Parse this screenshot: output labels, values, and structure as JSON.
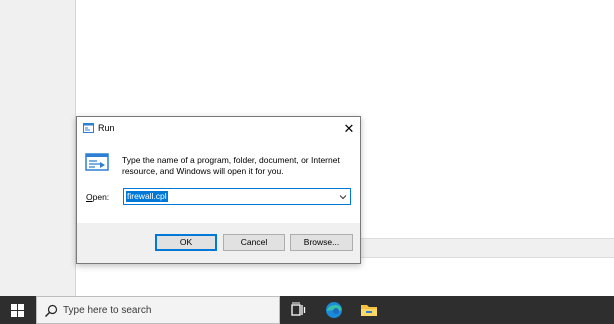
{
  "dialog": {
    "title": "Run",
    "close_glyph": "✕",
    "description": "Type the name of a program, folder, document, or Internet resource, and Windows will open it for you.",
    "open_label_accel": "O",
    "open_label_rest": "pen:",
    "open_value": "firewall.cpl",
    "ok_label": "OK",
    "cancel_label": "Cancel",
    "browse_label": "Browse..."
  },
  "taskbar": {
    "search_placeholder": "Type here to search",
    "icons": [
      "windows-start-icon",
      "search-icon",
      "task-view-icon",
      "edge-icon",
      "file-explorer-icon"
    ]
  },
  "colors": {
    "accent": "#0078d7",
    "taskbar": "#2e2e2e",
    "dialog_bg": "#f0f0f0"
  }
}
